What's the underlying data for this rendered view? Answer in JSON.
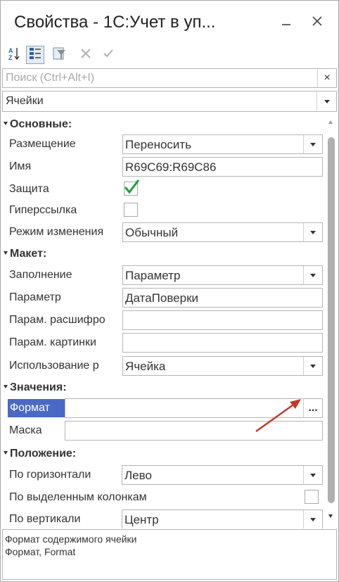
{
  "window": {
    "title": "Свойства - 1С:Учет в уп...",
    "minimize_glyph": "—",
    "close_glyph": "✕"
  },
  "toolbar": {
    "sort_alpha_icon": "sort-az-icon",
    "sort_category_icon": "categorize-icon",
    "filter_icon": "filter-icon",
    "cancel_icon": "cancel-icon",
    "apply_icon": "apply-icon"
  },
  "search": {
    "placeholder": "Поиск (Ctrl+Alt+I)",
    "value": "",
    "clear_glyph": "×"
  },
  "object_selector": {
    "value": "Ячейки"
  },
  "groups": [
    {
      "label": "Основные:",
      "props": [
        {
          "label": "Размещение",
          "value": "Переносить",
          "kind": "select"
        },
        {
          "label": "Имя",
          "value": "R69C69:R69C86",
          "kind": "text"
        },
        {
          "label": "Защита",
          "checked": true,
          "kind": "checkbox"
        },
        {
          "label": "Гиперссылка",
          "checked": false,
          "kind": "checkbox"
        },
        {
          "label": "Режим изменения",
          "value": "Обычный",
          "kind": "select"
        }
      ]
    },
    {
      "label": "Макет:",
      "props": [
        {
          "label": "Заполнение",
          "value": "Параметр",
          "kind": "select"
        },
        {
          "label": "Параметр",
          "value": "ДатаПоверки",
          "kind": "text"
        },
        {
          "label": "Парам. расшифро",
          "value": "",
          "kind": "text"
        },
        {
          "label": "Парам. картинки",
          "value": "",
          "kind": "text"
        },
        {
          "label": "Использование р",
          "value": "Ячейка",
          "kind": "select"
        }
      ]
    },
    {
      "label": "Значения:",
      "props": [
        {
          "label": "Формат",
          "value": "",
          "kind": "ellipsis",
          "selected": true,
          "button": "..."
        },
        {
          "label": "Маска",
          "value": "",
          "kind": "text"
        }
      ]
    },
    {
      "label": "Положение:",
      "props": [
        {
          "label": "По горизонтали",
          "value": "Лево",
          "kind": "select"
        },
        {
          "label": "По выделенным колонкам",
          "checked": false,
          "kind": "checkbox"
        },
        {
          "label": "По вертикали",
          "value": "Центр",
          "kind": "select"
        }
      ]
    }
  ],
  "description": {
    "line1": "Формат содержимого ячейки",
    "line2": "Формат, Format"
  },
  "colors": {
    "selection": "#4a69c4",
    "check": "#1f9d3a",
    "annotation_arrow": "#c0392b"
  }
}
